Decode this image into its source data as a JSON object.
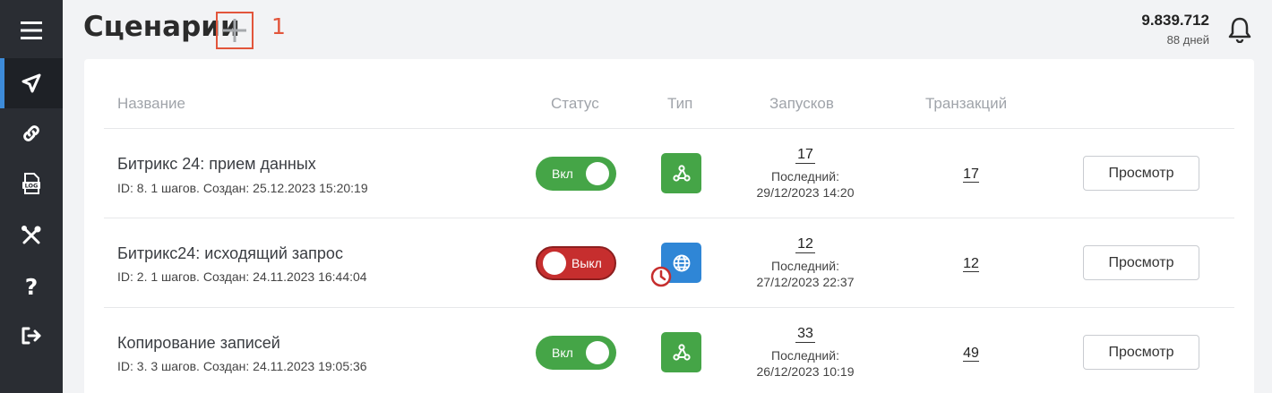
{
  "page": {
    "title": "Сценарии",
    "annotation": "1"
  },
  "account": {
    "balance": "9.839.712",
    "days_left": "88 дней"
  },
  "table": {
    "headers": {
      "name": "Название",
      "status": "Статус",
      "type": "Тип",
      "runs": "Запусков",
      "transactions": "Транзакций"
    },
    "rows": [
      {
        "name": "Битрикс 24: прием данных",
        "meta": "ID: 8. 1 шагов. Создан: 25.12.2023 15:20:19",
        "status": "Вкл",
        "enabled": true,
        "type_icon": "webhook-icon",
        "runs": "17",
        "last_label": "Последний:",
        "last_run": "29/12/2023 14:20",
        "transactions": "17",
        "view": "Просмотр"
      },
      {
        "name": "Битрикс24: исходящий запрос",
        "meta": "ID: 2. 1 шагов. Создан: 24.11.2023 16:44:04",
        "status": "Выкл",
        "enabled": false,
        "type_icon": "globe-icon",
        "scheduled": true,
        "runs": "12",
        "last_label": "Последний:",
        "last_run": "27/12/2023 22:37",
        "transactions": "12",
        "view": "Просмотр"
      },
      {
        "name": "Копирование записей",
        "meta": "ID: 3. 3 шагов. Создан: 24.11.2023 19:05:36",
        "status": "Вкл",
        "enabled": true,
        "type_icon": "webhook-icon",
        "runs": "33",
        "last_label": "Последний:",
        "last_run": "26/12/2023 10:19",
        "transactions": "49",
        "view": "Просмотр"
      }
    ]
  },
  "colors": {
    "sidebar": "#2a2d33",
    "accent": "#3d8bd9",
    "on": "#45a547",
    "off": "#c62e2e",
    "annotation": "#e2553b"
  },
  "sidebar": {
    "help_glyph": "?"
  }
}
